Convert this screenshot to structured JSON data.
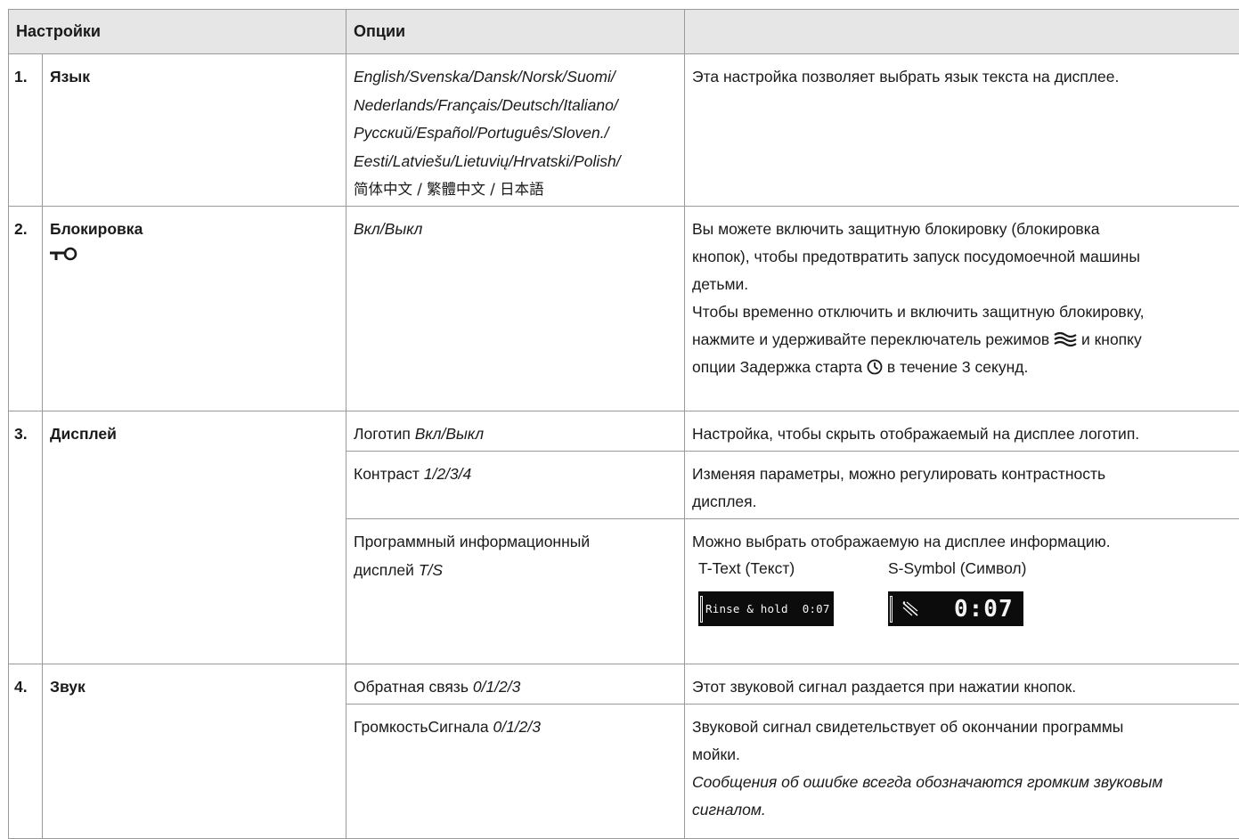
{
  "header": {
    "settings": "Настройки",
    "options": "Опции",
    "description": ""
  },
  "rows": {
    "language": {
      "num": "1.",
      "name": "Язык",
      "options_lines": [
        "English/Svenska/Dansk/Norsk/Suomi/",
        "Nederlands/Français/Deutsch/Italiano/",
        "Русский/Español/Português/Sloven./",
        "Eesti/Latviešu/Lietuvių/Hrvatski/Polish/"
      ],
      "options_cjk": "简体中文 / 繁體中文 / 日本語",
      "desc": "Эта настройка позволяет выбрать язык текста на дисплее."
    },
    "lock": {
      "num": "2.",
      "name": "Блокировка",
      "icon": "key-icon",
      "options": "Вкл/Выкл",
      "desc_lines": [
        "Вы можете включить защитную блокировку (блокировка",
        "кнопок), чтобы предотвратить запуск посудомоечной машины",
        "детьми."
      ],
      "desc2_line1": "Чтобы временно отключить и включить защитную блокировку,",
      "desc2_line2_a": "нажмите и удерживайте переключатель режимов",
      "desc2_line2_b": "и кнопку",
      "desc2_line3_a": "опции Задержка старта",
      "desc2_line3_b": "в течение 3 секунд.",
      "icon_program_selector": "program-selector-icon",
      "icon_delay_start": "clock-icon"
    },
    "display": {
      "num": "3.",
      "name": "Дисплей",
      "logo": {
        "label": "Логотип",
        "values": "Вкл/Выкл",
        "desc": "Настройка, чтобы скрыть отображаемый на дисплее логотип."
      },
      "contrast": {
        "label": "Контраст",
        "values": "1/2/3/4",
        "desc_line1": "Изменяя параметры, можно регулировать контрастность",
        "desc_line2": "дисплея."
      },
      "program_info": {
        "label_line1": "Программный информационный",
        "label_line2": "дисплей",
        "values": "T/S",
        "desc": "Можно выбрать отображаемую на дисплее информацию.",
        "text_label": "T-Text (Текст)",
        "symbol_label": "S-Symbol (Символ)",
        "text_screen": {
          "program": "Rinse & hold",
          "time": "0:07"
        },
        "symbol_screen": {
          "time": "0:07"
        }
      }
    },
    "sound": {
      "num": "4.",
      "name": "Звук",
      "feedback": {
        "label": "Обратная связь",
        "values": "0/1/2/3",
        "desc": "Этот звуковой сигнал раздается при нажатии кнопок."
      },
      "volume": {
        "label": "ГромкостьСигнала",
        "values": "0/1/2/3",
        "desc_line1": "Звуковой сигнал свидетельствует об окончании программы",
        "desc_line2": "мойки.",
        "note_line1": "Сообщения об ошибке всегда обозначаются громким звуковым",
        "note_line2": "сигналом."
      }
    }
  }
}
